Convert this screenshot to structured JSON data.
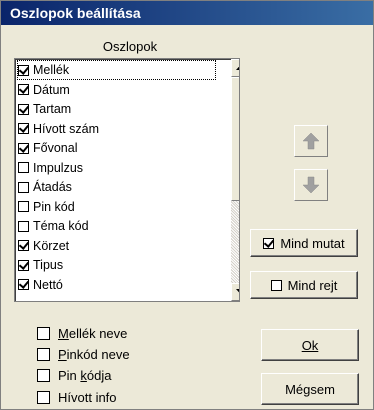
{
  "dialog": {
    "title": "Oszlopok beállítása",
    "list_header": "Oszlopok"
  },
  "columns": [
    {
      "label": "Mellék",
      "checked": true
    },
    {
      "label": "Dátum",
      "checked": true
    },
    {
      "label": "Tartam",
      "checked": true
    },
    {
      "label": "Hívott szám",
      "checked": true
    },
    {
      "label": "Fővonal",
      "checked": true
    },
    {
      "label": "Impulzus",
      "checked": false
    },
    {
      "label": "Átadás",
      "checked": false
    },
    {
      "label": "Pin kód",
      "checked": false
    },
    {
      "label": "Téma kód",
      "checked": false
    },
    {
      "label": "Körzet",
      "checked": true
    },
    {
      "label": "Tipus",
      "checked": true
    },
    {
      "label": "Nettó",
      "checked": true
    }
  ],
  "buttons": {
    "show_all": "Mind mutat",
    "hide_all": "Mind rejt",
    "ok": "Ok",
    "cancel": "Mégsem"
  },
  "options": [
    {
      "label": "Mellék neve",
      "checked": false
    },
    {
      "label": "Pinkód neve",
      "checked": false
    },
    {
      "label": "Pin kódja",
      "checked": false
    },
    {
      "label": "Hívott info",
      "checked": false
    }
  ],
  "icons": {
    "move_up": "arrow-up-icon",
    "move_down": "arrow-down-icon"
  },
  "colors": {
    "title_start": "#0a246a",
    "title_end": "#3a6ea5",
    "dialog_bg": "#ece9d8",
    "arrow_gray": "#a0a0a0"
  }
}
